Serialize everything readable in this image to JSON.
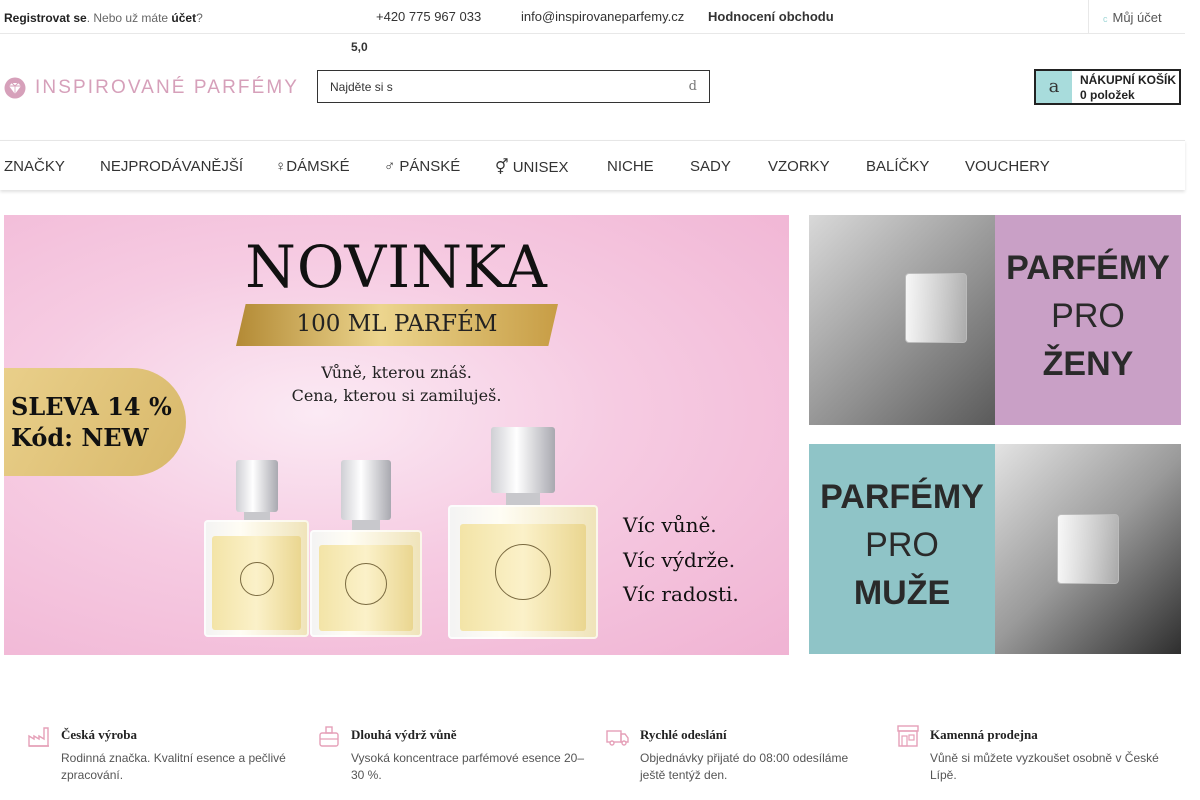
{
  "topbar": {
    "register_link": "Registrovat se",
    "register_middle": ". Nebo už máte ",
    "account_link": "účet",
    "register_end": "?",
    "phone_icon": "phone-icon",
    "phone": "+420 775 967 033",
    "email_icon": "mail-icon",
    "email": "info@inspirovaneparfemy.cz",
    "rating_link": "Hodnocení obchodu",
    "stars": "",
    "rating_value": "5,0",
    "my_account_icon": "user-icon",
    "my_account_icon_glyph": "c",
    "my_account": "Můj účet"
  },
  "header": {
    "logo_text": "INSPIROVANÉ PARFÉMY",
    "search_placeholder": "Najděte si s",
    "search_icon": "search-icon",
    "search_icon_glyph": "d",
    "cart_icon": "cart-icon",
    "cart_icon_glyph": "a",
    "cart_title": "NÁKUPNÍ KOŠÍK",
    "cart_count": "0 položek"
  },
  "nav": {
    "items": [
      "ZNAČKY",
      "NEJPRODÁVANĚJŠÍ",
      "♀DÁMSKÉ",
      "♂ PÁNSKÉ",
      "⚥ UNISEX",
      "NICHE",
      "SADY",
      "VZORKY",
      "BALÍČKY",
      "VOUCHERY"
    ]
  },
  "hero": {
    "title": "NOVINKA",
    "ribbon": "100 ML PARFÉM",
    "sub1": "Vůně, kterou znáš.",
    "sub2": "Cena, kterou si zamiluješ.",
    "badge1": "SLEVA 14 %",
    "badge2": "Kód: NEW",
    "claim1": "Víc vůně.",
    "claim2": "Víc výdrže.",
    "claim3": "Víc radosti.",
    "colors": {
      "pink": "#f4c3de",
      "gold": "#d8b86a"
    }
  },
  "banners": {
    "women": {
      "line1": "PARFÉMY",
      "line2": "PRO",
      "line3": "ŽENY",
      "color": "#c9a0c6"
    },
    "men": {
      "line1": "PARFÉMY",
      "line2": "PRO",
      "line3": "MUŽE",
      "color": "#8fc4c7"
    }
  },
  "features": [
    {
      "icon": "factory-icon",
      "title": "Česká výroba",
      "text": "Rodinná značka. Kvalitní esence a pečlivé zpracování."
    },
    {
      "icon": "bottle-icon",
      "title": "Dlouhá výdrž vůně",
      "text": "Vysoká koncentrace parfémové esence 20–30 %."
    },
    {
      "icon": "truck-icon",
      "title": "Rychlé odeslání",
      "text": "Objednávky přijaté do 08:00 odesíláme ještě tentýž den."
    },
    {
      "icon": "shop-icon",
      "title": "Kamenná prodejna",
      "text": "Vůně si můžete vyzkoušet osobně v České Lípě."
    }
  ],
  "colors": {
    "accent": "#d6a0ba",
    "teal": "#a8dcdc",
    "icon_pink": "#e5a0b8"
  }
}
